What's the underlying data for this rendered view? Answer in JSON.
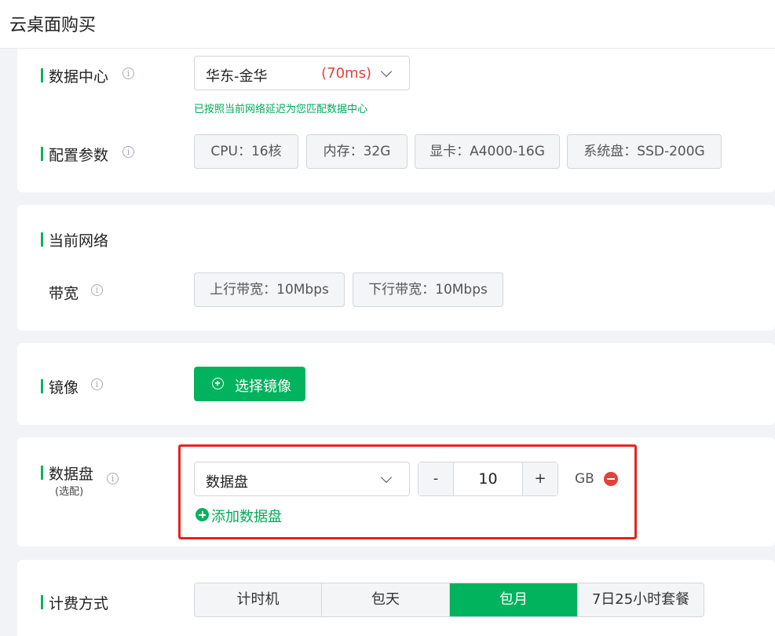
{
  "page": {
    "title": "云桌面购买"
  },
  "data_center": {
    "label": "数据中心",
    "info_icon": "info-icon",
    "selected_value": "华东-金华",
    "latency": "(70ms)",
    "hint": "已按照当前网络延迟为您匹配数据中心"
  },
  "config": {
    "label": "配置参数",
    "tags": [
      "CPU：16核",
      "内存：32G",
      "显卡：A4000-16G",
      "系统盘：SSD-200G"
    ]
  },
  "network": {
    "label": "当前网络",
    "bandwidth_label": "带宽",
    "tags": [
      "上行带宽：10Mbps",
      "下行带宽：10Mbps"
    ]
  },
  "image": {
    "label": "镜像",
    "button_label": "选择镜像"
  },
  "data_disk": {
    "label": "数据盘",
    "sublabel": "(选配)",
    "selected_value": "数据盘",
    "minus": "-",
    "plus": "+",
    "quantity": "10",
    "unit": "GB",
    "add_label": "添加数据盘",
    "highlight_color": "#e8231c"
  },
  "billing": {
    "label": "计费方式",
    "options": [
      "计时机",
      "包天",
      "包月",
      "7日25小时套餐"
    ],
    "selected": "包月"
  },
  "colors": {
    "accent": "#00b35c",
    "danger": "#e5403a",
    "latency": "#e0413a"
  }
}
